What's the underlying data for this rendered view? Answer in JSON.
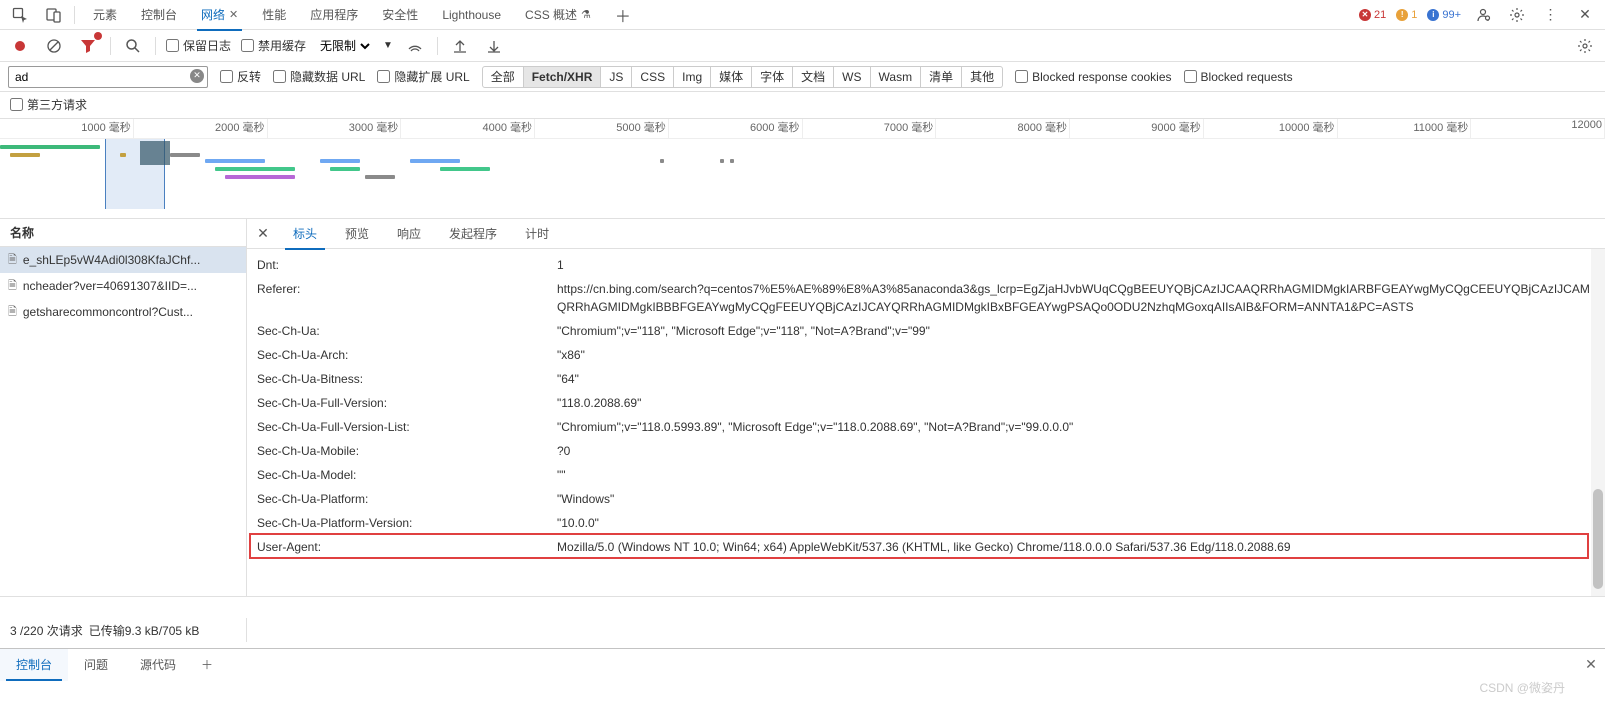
{
  "topTabs": {
    "items": [
      "元素",
      "控制台",
      "网络",
      "性能",
      "应用程序",
      "安全性",
      "Lighthouse",
      "CSS 概述"
    ],
    "activeIndex": 2,
    "hasCloseOn": 2,
    "hasBetaOn": 7
  },
  "badges": {
    "errors": "21",
    "warnings": "1",
    "info": "99+"
  },
  "toolbar": {
    "preserveLog": "保留日志",
    "disableCache": "禁用缓存",
    "throttling": "无限制"
  },
  "filter": {
    "value": "ad",
    "invert": "反转",
    "hideDataUrl": "隐藏数据 URL",
    "hideExtUrl": "隐藏扩展 URL",
    "types": [
      "全部",
      "Fetch/XHR",
      "JS",
      "CSS",
      "Img",
      "媒体",
      "字体",
      "文档",
      "WS",
      "Wasm",
      "清单",
      "其他"
    ],
    "activeType": 1,
    "blockedCookies": "Blocked response cookies",
    "blockedReq": "Blocked requests",
    "thirdParty": "第三方请求"
  },
  "timeline": {
    "ticks": [
      "1000 毫秒",
      "2000 毫秒",
      "3000 毫秒",
      "4000 毫秒",
      "5000 毫秒",
      "6000 毫秒",
      "7000 毫秒",
      "8000 毫秒",
      "9000 毫秒",
      "10000 毫秒",
      "11000 毫秒",
      "12000"
    ]
  },
  "requests": {
    "header": "名称",
    "items": [
      "e_shLEp5vW4Adi0l308KfaJChf...",
      "ncheader?ver=40691307&IID=...",
      "getsharecommoncontrol?Cust..."
    ],
    "selected": 0
  },
  "detailTabs": {
    "items": [
      "标头",
      "预览",
      "响应",
      "发起程序",
      "计时"
    ],
    "active": 0
  },
  "headersList": [
    {
      "name": "Dnt:",
      "value": "1"
    },
    {
      "name": "Referer:",
      "value": "https://cn.bing.com/search?q=centos7%E5%AE%89%E8%A3%85anaconda3&gs_lcrp=EgZjaHJvbWUqCQgBEEUYQBjCAzIJCAAQRRhAGMIDMgkIARBFGEAYwgMyCQgCEEUYQBjCAzIJCAMQRRhAGMIDMgkIBBBFGEAYwgMyCQgFEEUYQBjCAzIJCAYQRRhAGMIDMgkIBxBFGEAYwgPSAQo0ODU2NzhqMGoxqAIIsAIB&FORM=ANNTA1&PC=ASTS"
    },
    {
      "name": "Sec-Ch-Ua:",
      "value": "\"Chromium\";v=\"118\", \"Microsoft Edge\";v=\"118\", \"Not=A?Brand\";v=\"99\""
    },
    {
      "name": "Sec-Ch-Ua-Arch:",
      "value": "\"x86\""
    },
    {
      "name": "Sec-Ch-Ua-Bitness:",
      "value": "\"64\""
    },
    {
      "name": "Sec-Ch-Ua-Full-Version:",
      "value": "\"118.0.2088.69\""
    },
    {
      "name": "Sec-Ch-Ua-Full-Version-List:",
      "value": "\"Chromium\";v=\"118.0.5993.89\", \"Microsoft Edge\";v=\"118.0.2088.69\", \"Not=A?Brand\";v=\"99.0.0.0\""
    },
    {
      "name": "Sec-Ch-Ua-Mobile:",
      "value": "?0"
    },
    {
      "name": "Sec-Ch-Ua-Model:",
      "value": "\"\""
    },
    {
      "name": "Sec-Ch-Ua-Platform:",
      "value": "\"Windows\""
    },
    {
      "name": "Sec-Ch-Ua-Platform-Version:",
      "value": "\"10.0.0\""
    },
    {
      "name": "User-Agent:",
      "value": "Mozilla/5.0 (Windows NT 10.0; Win64; x64) AppleWebKit/537.36 (KHTML, like Gecko) Chrome/118.0.0.0 Safari/537.36 Edg/118.0.2088.69"
    }
  ],
  "status": {
    "requests": "3 /220 次请求",
    "transferred": "已传输9.3 kB/705 kB"
  },
  "drawer": {
    "tabs": [
      "控制台",
      "问题",
      "源代码"
    ],
    "active": 0
  },
  "watermark": "CSDN @微姿丹"
}
